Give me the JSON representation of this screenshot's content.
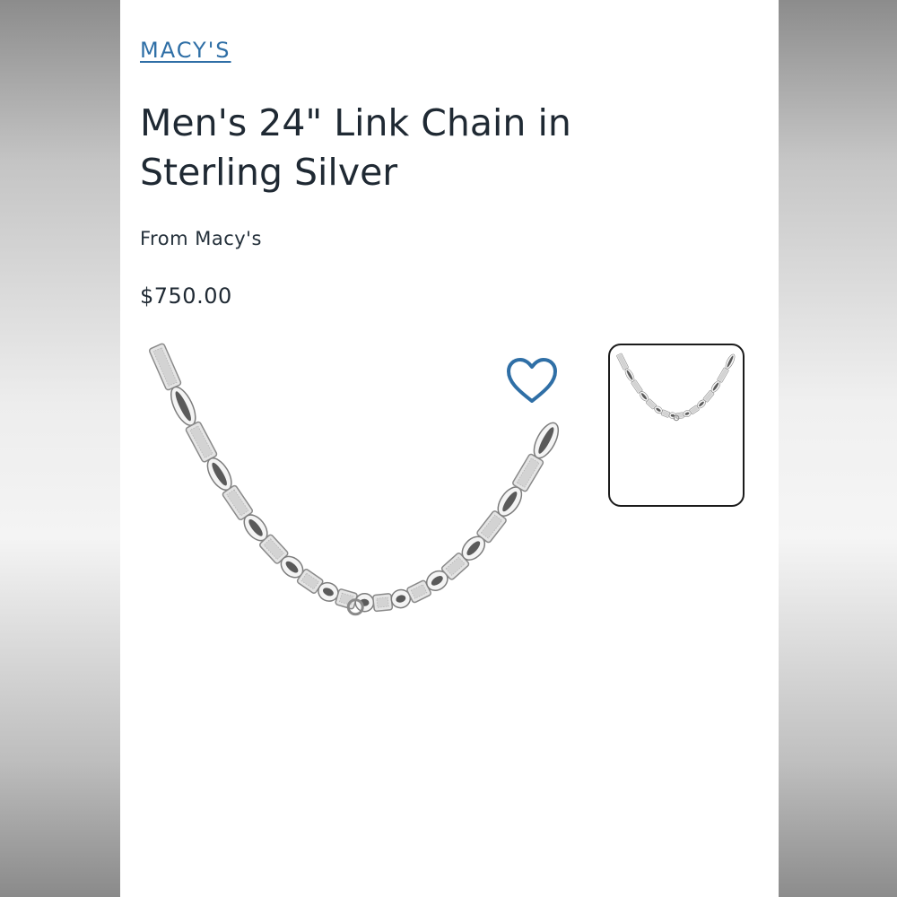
{
  "product": {
    "brand_link": "MACY'S",
    "title": "Men's 24\" Link Chain in Sterling Silver",
    "seller": "From Macy's",
    "price": "$750.00"
  },
  "icons": {
    "favorite": "heart-outline-icon"
  },
  "colors": {
    "brand_link": "#2f6fa6",
    "heart": "#2f6fa6",
    "text": "#1f2933"
  }
}
